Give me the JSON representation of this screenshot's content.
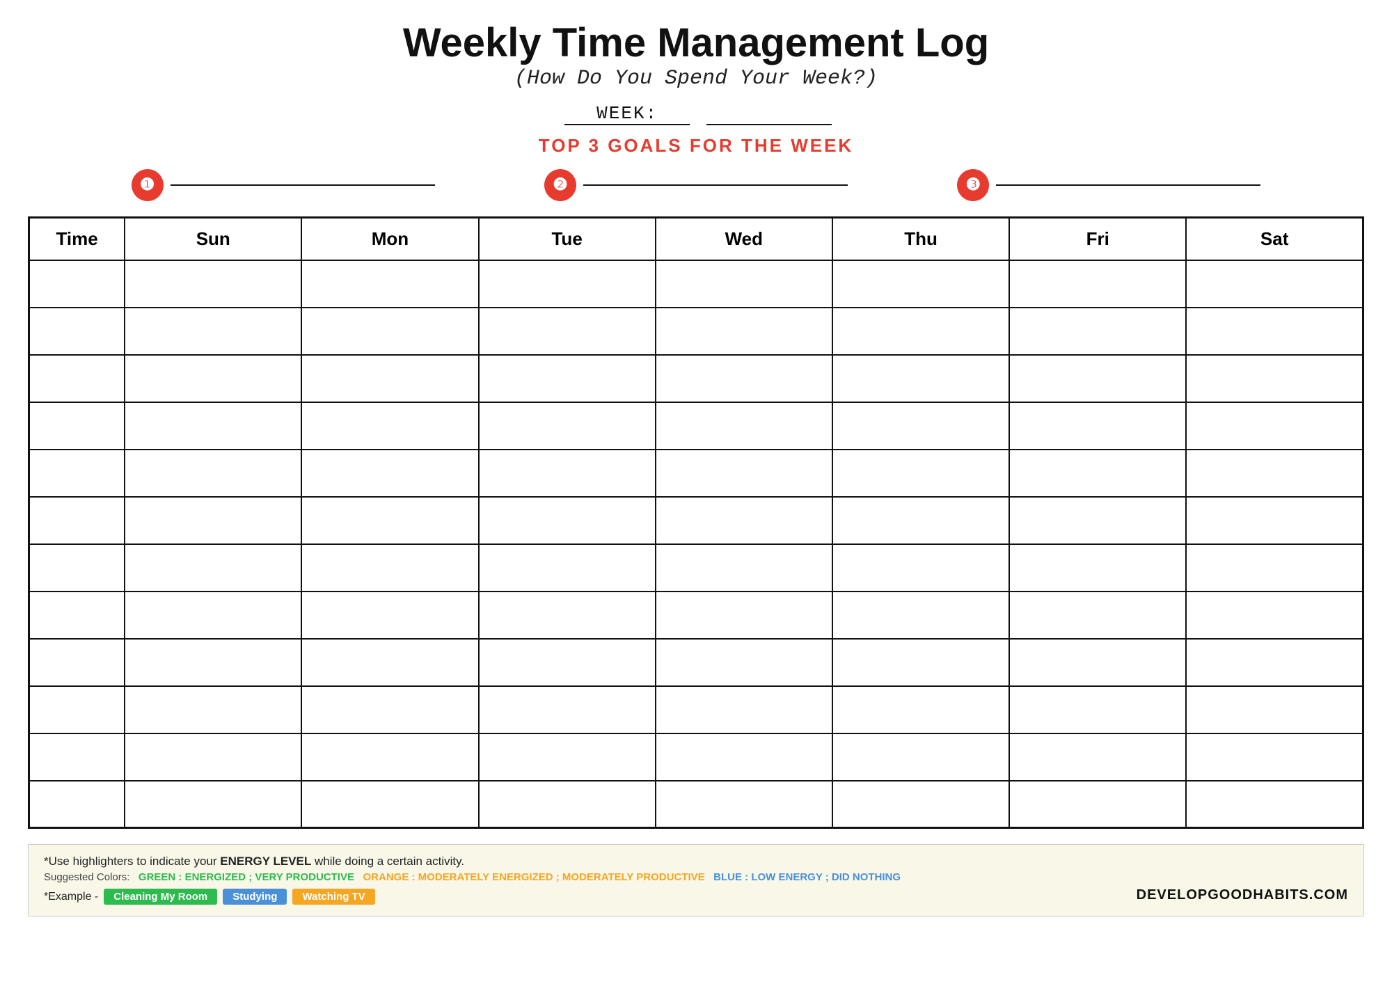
{
  "header": {
    "title": "Weekly Time Management Log",
    "subtitle": "(How Do You Spend Your Week?)",
    "week_label": "WEEK:",
    "goals_heading": "TOP 3 GOALS FOR THE WEEK",
    "goal_numbers": [
      "❶",
      "❷",
      "❸"
    ]
  },
  "table": {
    "columns": [
      "Time",
      "Sun",
      "Mon",
      "Tue",
      "Wed",
      "Thu",
      "Fri",
      "Sat"
    ],
    "row_count": 12
  },
  "footer": {
    "hint_text": "*Use highlighters to indicate your ENERGY LEVEL while doing a certain activity.",
    "colors_label": "Suggested Colors:",
    "green_label": "GREEN : ENERGIZED ; VERY PRODUCTIVE",
    "orange_label": "ORANGE : MODERATELY ENERGIZED ; MODERATELY PRODUCTIVE",
    "blue_label": "BLUE : LOW ENERGY ; DID NOTHING",
    "example_label": "*Example -",
    "example_tags": [
      {
        "label": "Cleaning My Room",
        "color": "green"
      },
      {
        "label": "Studying",
        "color": "blue"
      },
      {
        "label": "Watching TV",
        "color": "orange"
      }
    ],
    "watermark": "DEVELOPGOODHABITS.COM"
  }
}
